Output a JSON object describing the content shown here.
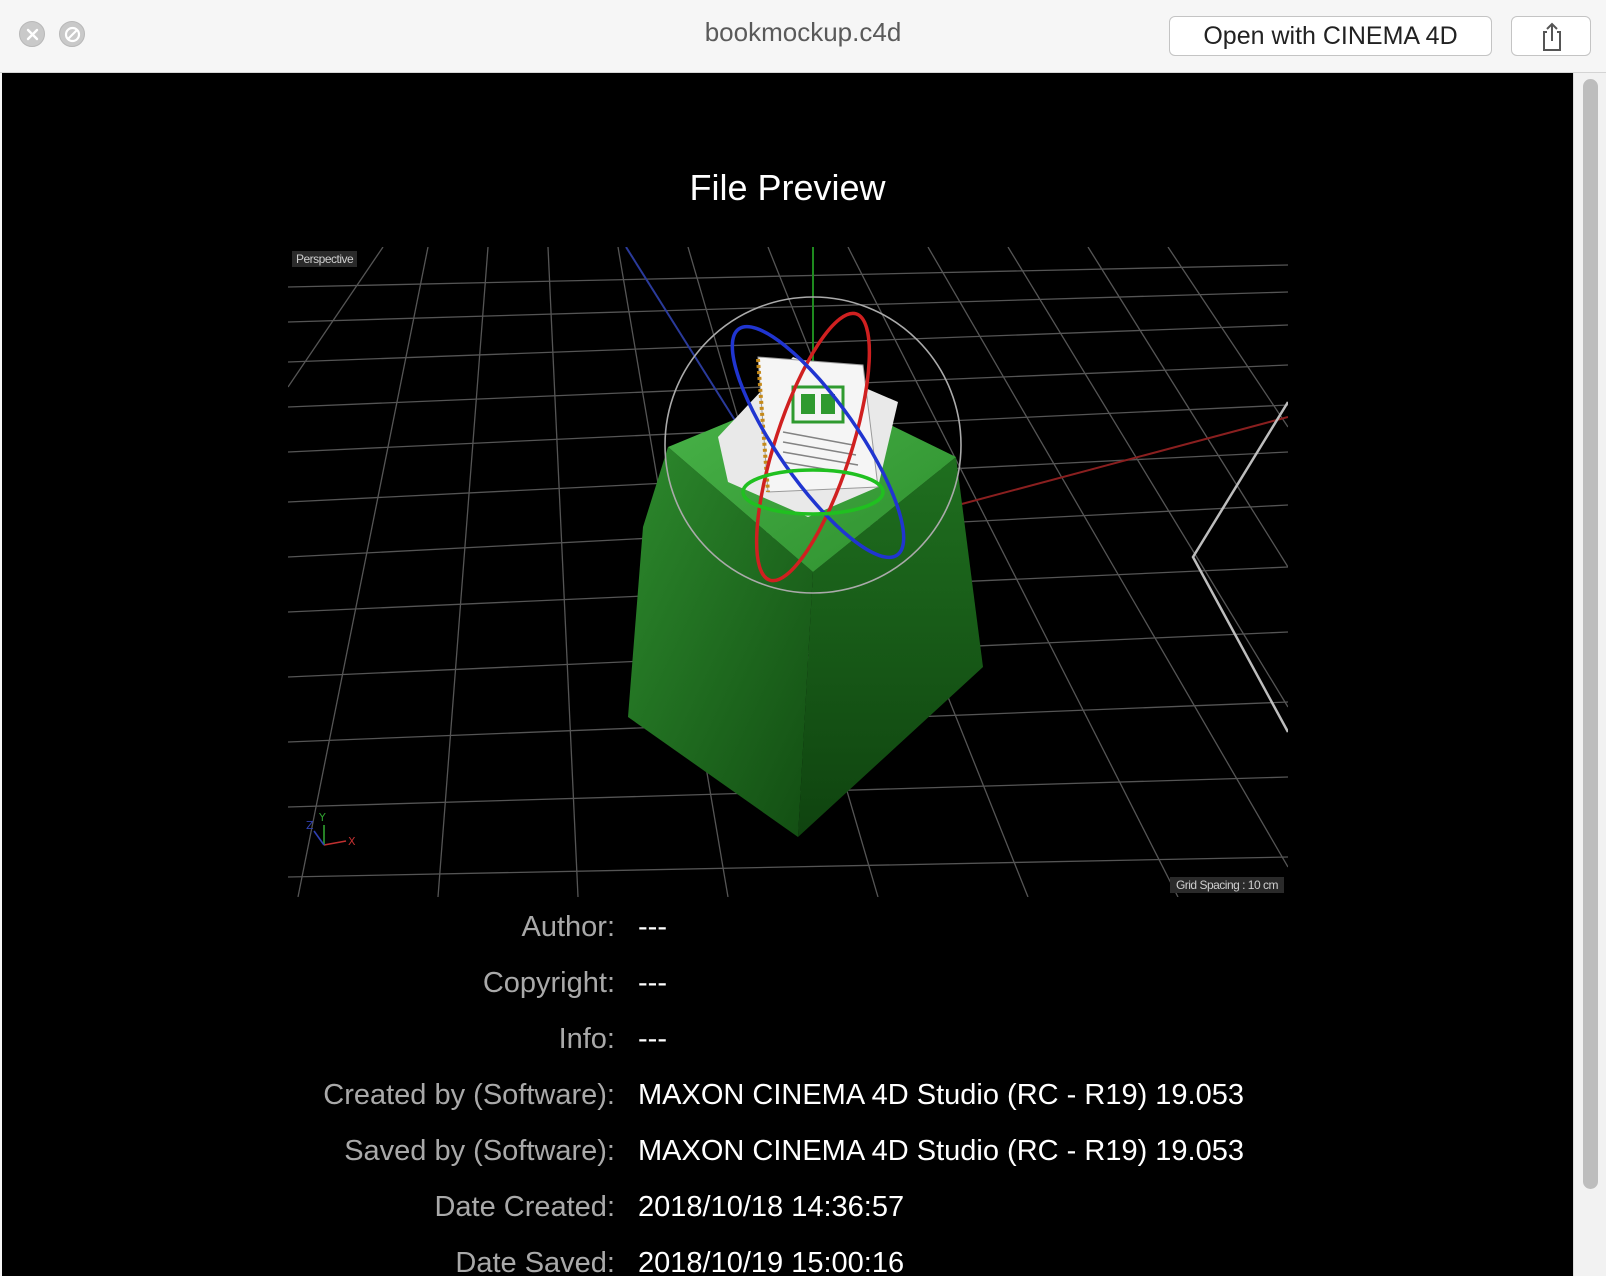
{
  "window": {
    "title": "bookmockup.c4d",
    "open_with_label": "Open with CINEMA 4D",
    "icons": {
      "close": "close-icon",
      "fullscreen": "fullscreen-icon",
      "share": "share-icon"
    }
  },
  "preview": {
    "heading": "File Preview",
    "viewport_label": "Perspective",
    "grid_spacing_label": "Grid Spacing : 10 cm",
    "colors": {
      "object_green": "#2f8a2f",
      "background": "#000000",
      "grid": "#5a5a5a"
    }
  },
  "info": [
    {
      "label": "Author:",
      "value": "---"
    },
    {
      "label": "Copyright:",
      "value": "---"
    },
    {
      "label": "Info:",
      "value": "---"
    },
    {
      "label": "Created by (Software):",
      "value": "MAXON CINEMA 4D Studio (RC - R19) 19.053"
    },
    {
      "label": "Saved by (Software):",
      "value": "MAXON CINEMA 4D Studio (RC - R19) 19.053"
    },
    {
      "label": "Date Created:",
      "value": "2018/10/18 14:36:57"
    },
    {
      "label": "Date Saved:",
      "value": "2018/10/19 15:00:16"
    }
  ]
}
